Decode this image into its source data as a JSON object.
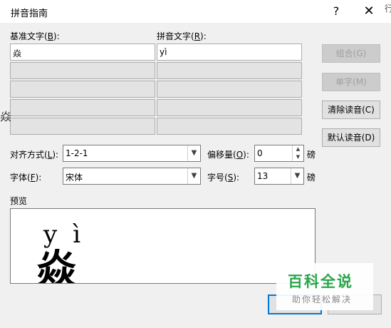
{
  "titlebar": {
    "title": "拼音指南",
    "help": "?",
    "close": "✕"
  },
  "labels": {
    "base_text": "基准文字(",
    "base_key": "B",
    "pinyin_text": "拼音文字(",
    "pinyin_key": "R",
    "align": "对齐方式(",
    "align_key": "L",
    "offset": "偏移量(",
    "offset_key": "O",
    "font": "字体(",
    "font_key": "F",
    "size": "字号(",
    "size_key": "S",
    "close_paren": "):",
    "pt1": "磅",
    "pt2": "磅",
    "preview": "预览"
  },
  "grid": {
    "base": [
      "焱",
      "",
      "",
      "",
      ""
    ],
    "pinyin": [
      "yì",
      "",
      "",
      "",
      ""
    ]
  },
  "buttons": {
    "combine": "组合(G)",
    "single": "单字(M)",
    "clear": "清除读音(C)",
    "default": "默认读音(D)"
  },
  "fields": {
    "align_value": "1-2-1",
    "offset_value": "0",
    "font_value": "宋体",
    "size_value": "13"
  },
  "preview": {
    "pinyin": "yì",
    "base_char": "焱"
  },
  "watermark": {
    "logo": "百科全说",
    "slogan": "助你轻松解决"
  },
  "edge_text": {
    "left": "焱",
    "right": "行"
  }
}
